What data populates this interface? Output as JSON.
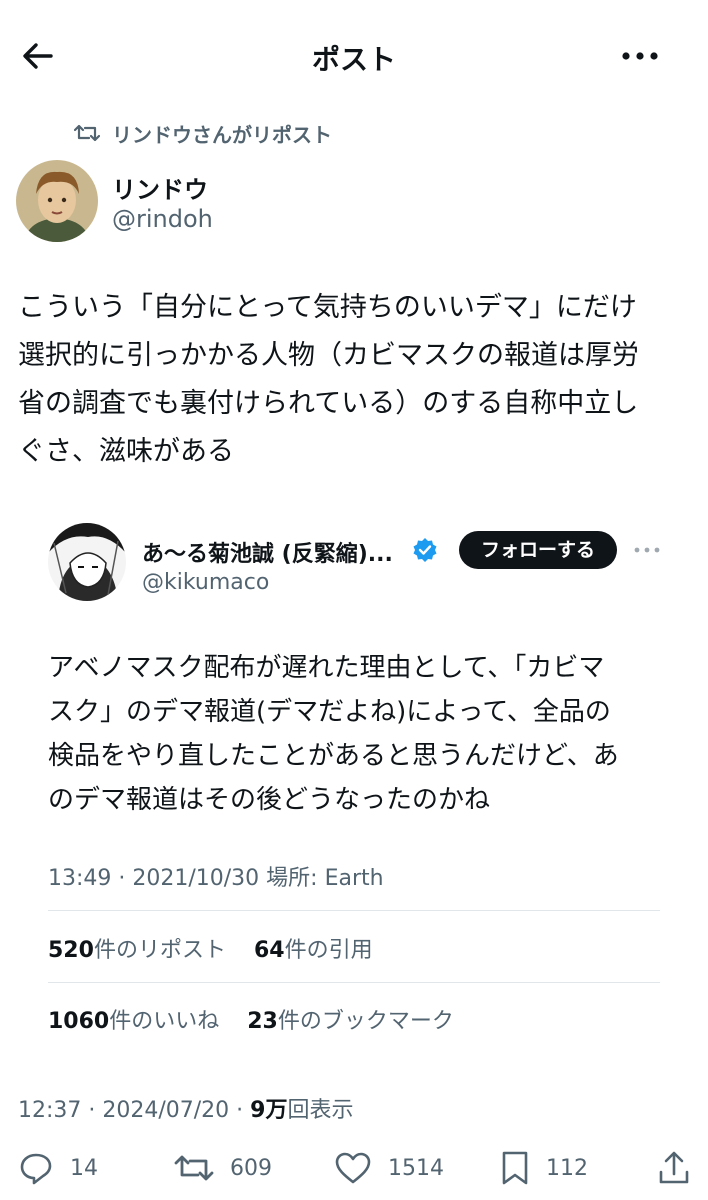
{
  "header": {
    "title": "ポスト"
  },
  "repost": {
    "text": "リンドウさんがリポスト"
  },
  "author": {
    "name": "リンドウ",
    "handle": "@rindoh"
  },
  "post": {
    "text": "こういう「自分にとって気持ちのいいデマ」にだけ\n選択的に引っかかる人物（カビマスクの報道は厚労\n省の調査でも裏付けられている）のする自称中立し\nぐさ、滋味がある"
  },
  "quoted": {
    "name": "あ〜る菊池誠 (反緊縮)...",
    "handle": "@kikumaco",
    "follow_label": "フォローする",
    "text": "アベノマスク配布が遅れた理由として、「カビマ\nスク」のデマ報道(デマだよね)によって、全品の\n検品をやり直したことがあると思うんだけど、あ\nのデマ報道はその後どうなったのかね",
    "meta": "13:49 · 2021/10/30 場所: Earth",
    "reposts": {
      "count": "520",
      "label": "件のリポスト"
    },
    "quotes": {
      "count": "64",
      "label": "件の引用"
    },
    "likes": {
      "count": "1060",
      "label": "件のいいね"
    },
    "bookmarks": {
      "count": "23",
      "label": "件のブックマーク"
    }
  },
  "meta": {
    "time": "12:37 · 2024/07/20 · ",
    "views": "9万",
    "views_label": "回表示"
  },
  "actions": {
    "replies": "14",
    "reposts": "609",
    "likes": "1514",
    "bookmarks": "112"
  },
  "icons": [
    "back-arrow-icon",
    "more-icon",
    "repost-icon",
    "verified-badge-icon",
    "reply-icon",
    "like-icon",
    "bookmark-icon",
    "share-icon"
  ],
  "colors": {
    "text": "#0f1419",
    "secondary": "#536471",
    "verified": "#1d9bf0",
    "button": "#0f1419"
  }
}
